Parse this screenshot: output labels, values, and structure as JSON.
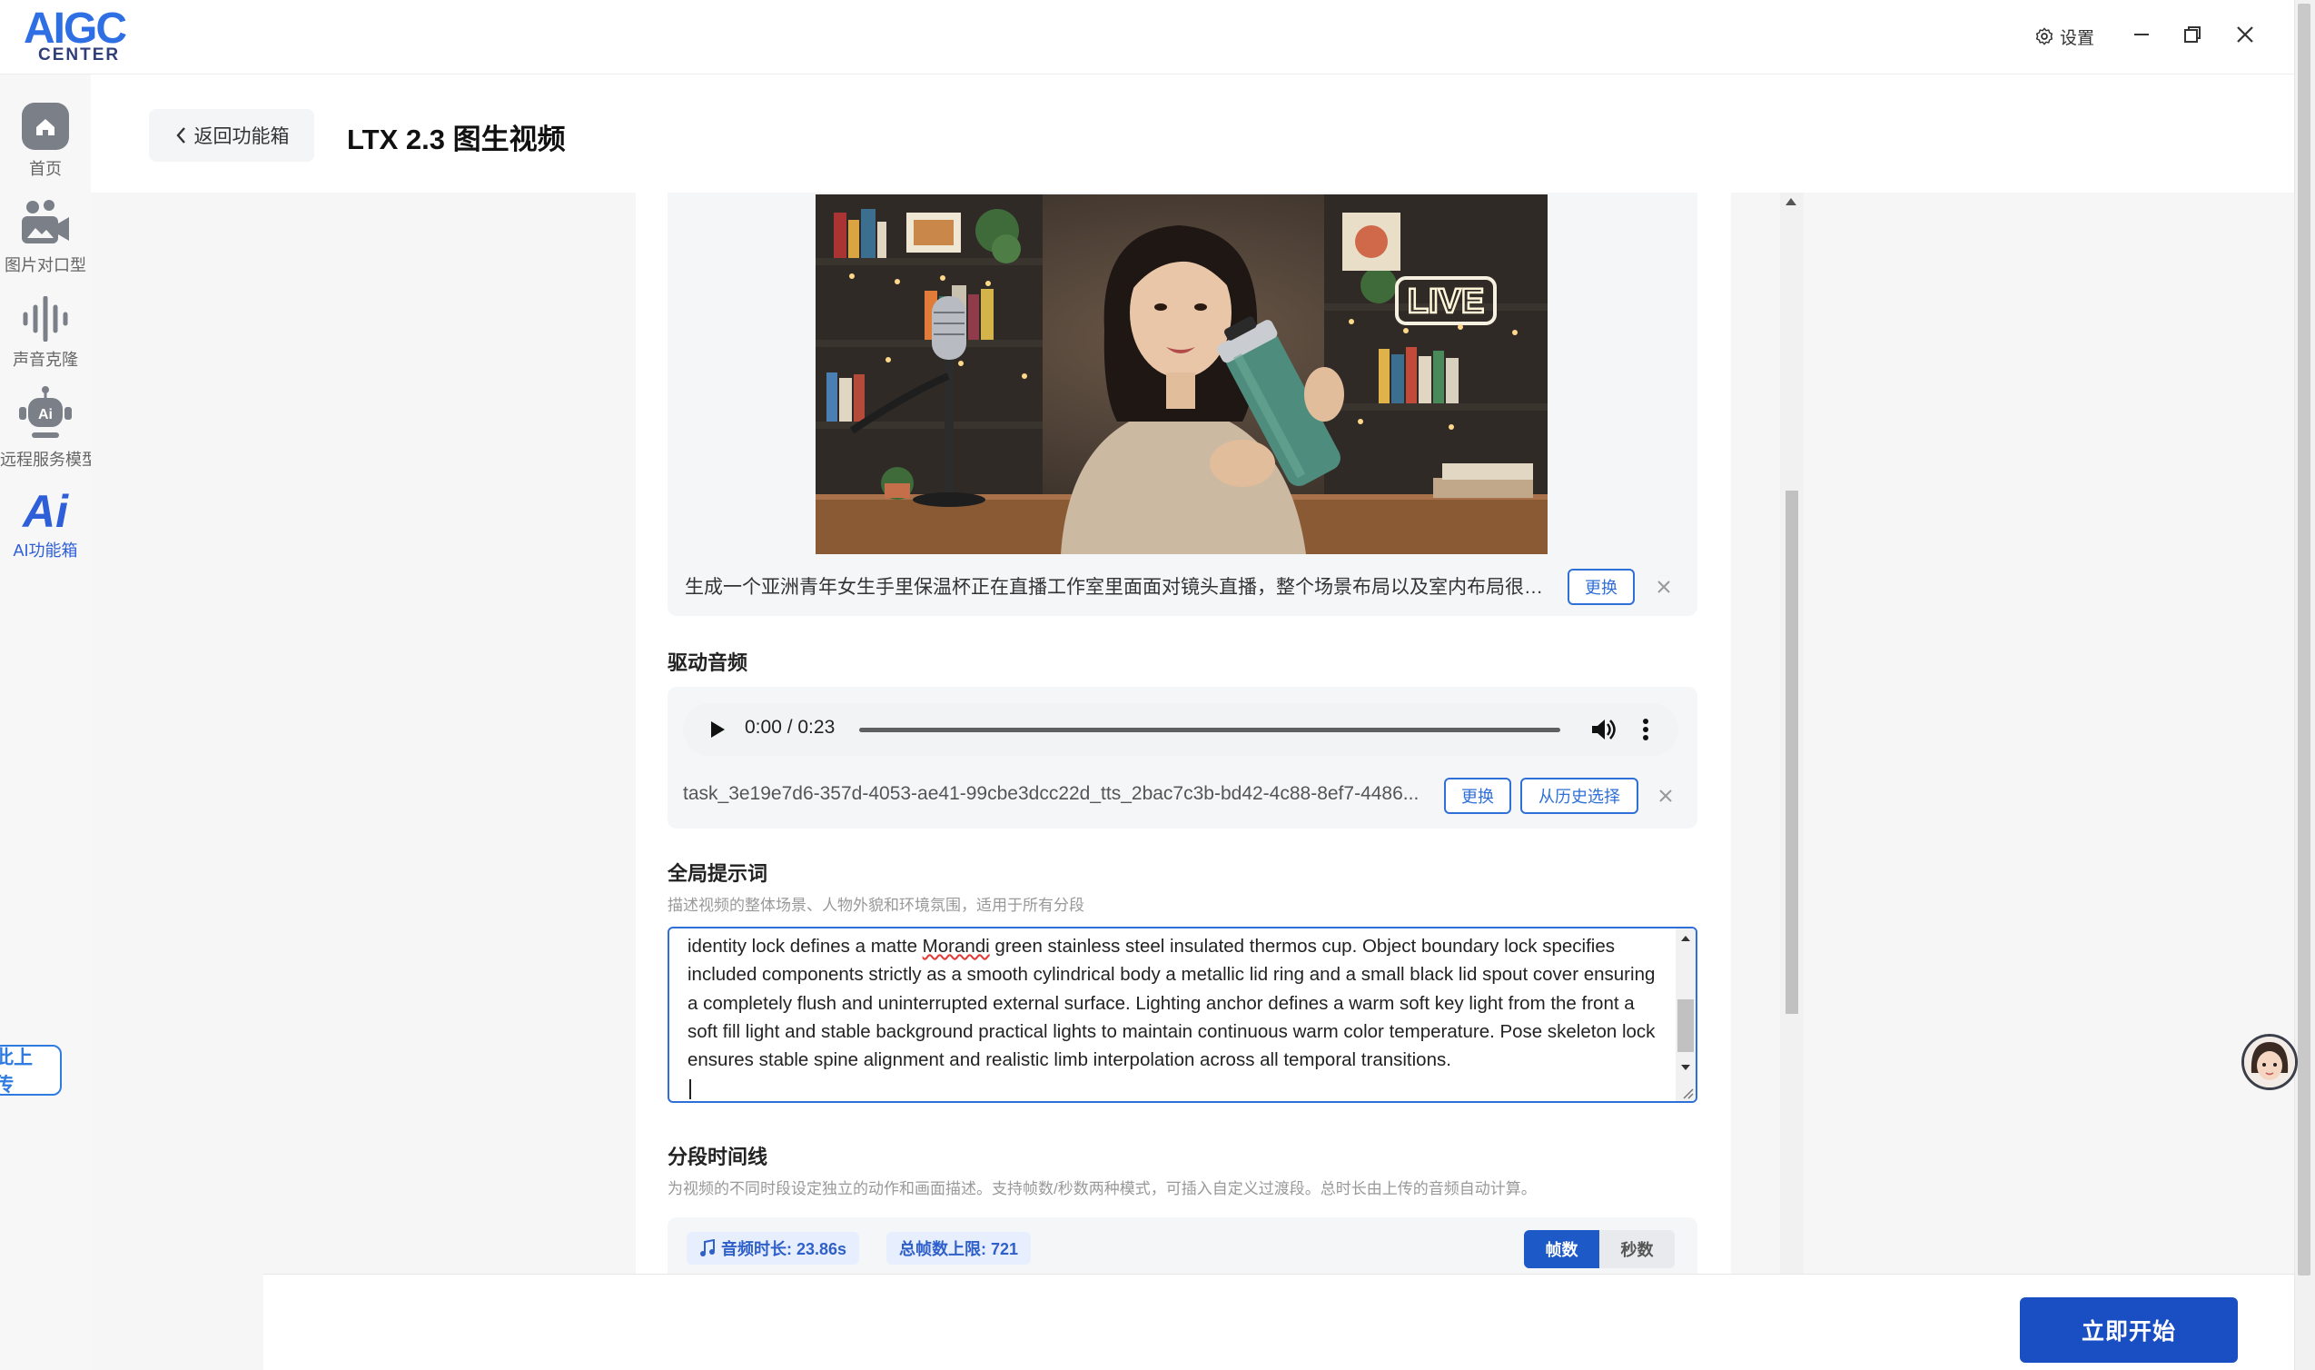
{
  "app": {
    "logo_main": "AIGC",
    "logo_sub": "CENTER",
    "settings_label": "设置"
  },
  "nav": {
    "items": [
      {
        "label": "首页",
        "icon": "home-icon"
      },
      {
        "label": "图片对口型",
        "icon": "image-lipsync-icon"
      },
      {
        "label": "声音克隆",
        "icon": "voice-clone-icon"
      },
      {
        "label": "远程服务模型",
        "icon": "robot-icon"
      },
      {
        "label": "AI功能箱",
        "icon": "ai-toolbox-icon",
        "active": true
      }
    ],
    "upload_tab": "此上传"
  },
  "header": {
    "back_label": "返回功能箱",
    "title": "LTX 2.3 图生视频"
  },
  "image_section": {
    "caption": "生成一个亚洲青年女生手里保温杯正在直播工作室里面面对镜头直播，整个场景布局以及室内布局很丰富，以...",
    "replace_label": "更换",
    "live_sign": "LIVE"
  },
  "audio_section": {
    "title": "驱动音频",
    "time": "0:00 / 0:23",
    "file_name": "task_3e19e7d6-357d-4053-ae41-99cbe3dcc22d_tts_2bac7c3b-bd42-4c88-8ef7-4486...",
    "replace_label": "更换",
    "history_label": "从历史选择"
  },
  "prompt_section": {
    "title": "全局提示词",
    "subtitle": "描述视频的整体场景、人物外貌和环境氛围，适用于所有分段",
    "text_before": "identity lock defines a matte ",
    "text_misspelled": "Morandi",
    "text_after": " green stainless steel insulated thermos cup. Object boundary lock specifies included components strictly as a smooth cylindrical body a metallic lid ring and a small black lid spout cover ensuring a completely flush and uninterrupted external surface. Lighting anchor defines a warm soft key light from the front a soft fill light and stable background practical lights to maintain continuous warm color temperature. Pose skeleton lock ensures stable spine alignment and realistic limb interpolation across all temporal transitions."
  },
  "timeline_section": {
    "title": "分段时间线",
    "subtitle": "为视频的不同时段设定独立的动作和画面描述。支持帧数/秒数两种模式，可插入自定义过渡段。总时长由上传的音频自动计算。",
    "audio_duration": "音频时长: 23.86s",
    "frame_limit": "总帧数上限: 721",
    "mode_frames": "帧数",
    "mode_seconds": "秒数"
  },
  "footer": {
    "start_label": "立即开始"
  },
  "colors": {
    "accent": "#2f6fd8",
    "primary_button": "#1a4fc4"
  }
}
